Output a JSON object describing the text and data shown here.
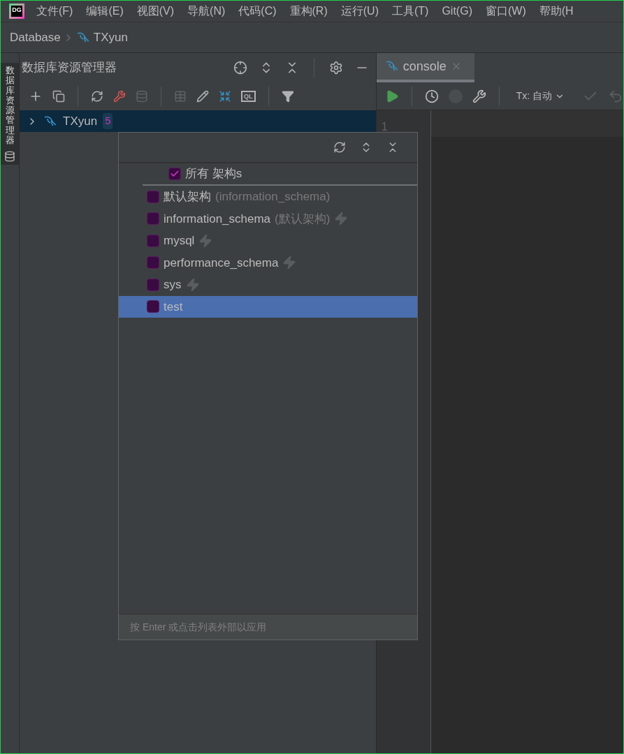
{
  "logo_text": "DG",
  "menu": [
    "文件(F)",
    "编辑(E)",
    "视图(V)",
    "导航(N)",
    "代码(C)",
    "重构(R)",
    "运行(U)",
    "工具(T)",
    "Git(G)",
    "窗口(W)",
    "帮助(H"
  ],
  "breadcrumb": [
    "Database",
    "TXyun"
  ],
  "side_tab": {
    "label": "数据库资源管理器"
  },
  "explorer": {
    "title": "数据库资源管理器",
    "ql_label": "QL",
    "tree": [
      {
        "label": "TXyun",
        "badge": "5",
        "expanded": false,
        "selected": true
      }
    ]
  },
  "editor": {
    "tab": {
      "label": "console"
    },
    "tx_label": "Tx: 自动",
    "line_numbers": [
      "1"
    ]
  },
  "schema_popup": {
    "all_item": {
      "label": "所有 架构s",
      "checked": true
    },
    "items": [
      {
        "name": "默认架构",
        "note": "(information_schema)",
        "checked": false,
        "selected": false,
        "introspected": false
      },
      {
        "name": "information_schema",
        "note": "(默认架构)",
        "checked": false,
        "selected": false,
        "introspected": true
      },
      {
        "name": "mysql",
        "checked": false,
        "selected": false,
        "introspected": true
      },
      {
        "name": "performance_schema",
        "checked": false,
        "selected": false,
        "introspected": true
      },
      {
        "name": "sys",
        "checked": false,
        "selected": false,
        "introspected": true
      },
      {
        "name": "test",
        "checked": false,
        "selected": true,
        "introspected": false
      }
    ],
    "hint": "按 Enter 或点击列表外部以应用"
  }
}
